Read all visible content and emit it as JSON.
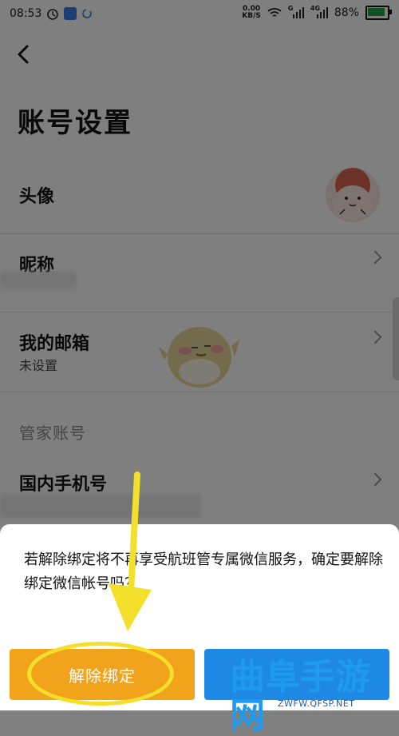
{
  "status_bar": {
    "time": "08:53",
    "net_speed_value": "0.00",
    "net_speed_unit": "KB/S",
    "signal_1_label": "G",
    "signal_2_label": "4G",
    "battery_percent": "88%",
    "battery_level": 0.88
  },
  "page": {
    "title": "账号设置",
    "rows": {
      "avatar": {
        "label": "头像"
      },
      "nickname": {
        "label": "昵称"
      },
      "email": {
        "label": "我的邮箱",
        "value": "未设置"
      },
      "section": "管家账号",
      "phone": {
        "label": "国内手机号"
      }
    }
  },
  "dialog": {
    "message": "若解除绑定将不再享受航班管专属微信服务，确定要解除绑定微信帐号吗？",
    "unbind_label": "解除绑定",
    "other_label": ""
  },
  "watermark": {
    "main": "曲阜手游网",
    "sub": "ZWFW.QFSP.NET"
  },
  "colors": {
    "accent_orange": "#f2a31c",
    "accent_blue": "#1e88e5",
    "highlight_yellow": "#f4df2b",
    "watermark_blue": "#1e9bf0"
  }
}
